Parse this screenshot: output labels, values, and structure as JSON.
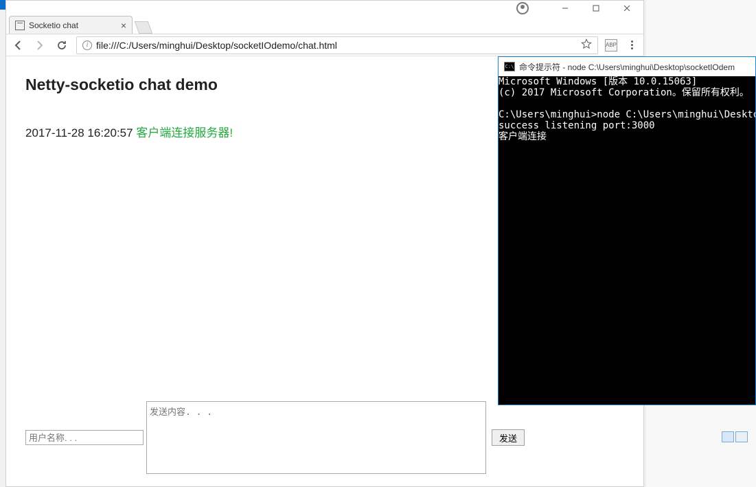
{
  "browser": {
    "tab_title": "Socketio chat",
    "url": "file:///C:/Users/minghui/Desktop/socketIOdemo/chat.html"
  },
  "page": {
    "heading": "Netty-socketio chat demo",
    "timestamp": "2017-11-28 16:20:57",
    "message": "客户端连接服务器!",
    "name_placeholder": "用户名称. . .",
    "content_placeholder": "发送内容. . .",
    "send_label": "发送"
  },
  "console": {
    "title": "命令提示符 - node  C:\\Users\\minghui\\Desktop\\socketIOdem",
    "lines": [
      "Microsoft Windows [版本 10.0.15063]",
      "(c) 2017 Microsoft Corporation。保留所有权利。",
      "",
      "C:\\Users\\minghui>node C:\\Users\\minghui\\Desktop\\",
      "success listening port:3000",
      "客户端连接"
    ]
  }
}
